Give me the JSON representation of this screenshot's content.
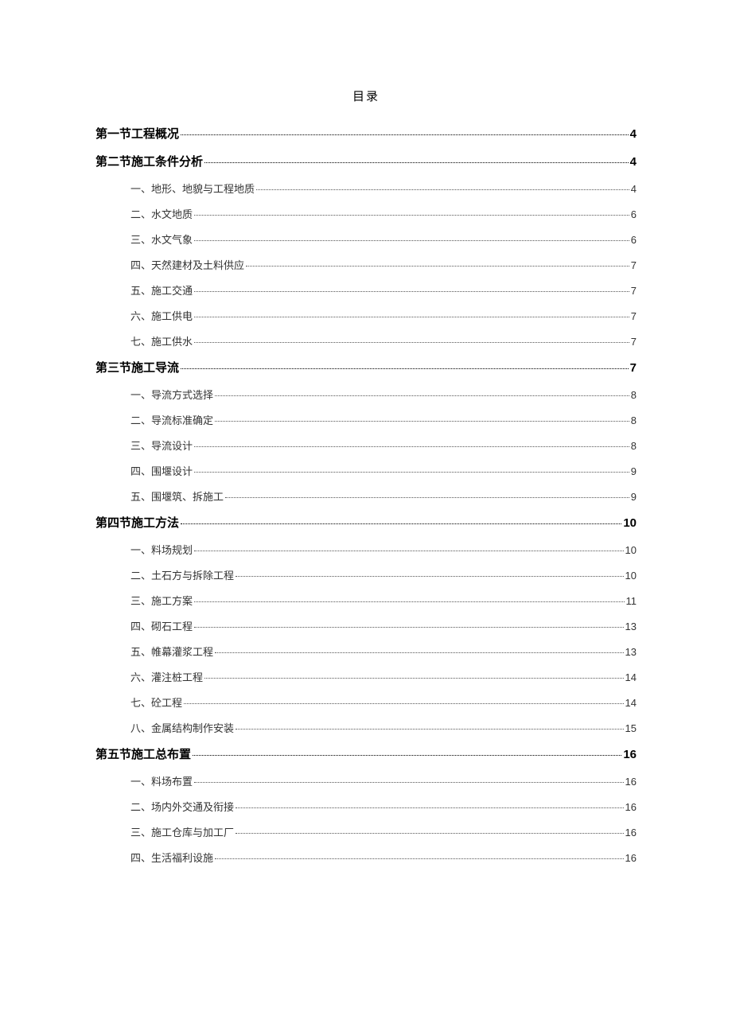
{
  "title": "目录",
  "entries": [
    {
      "level": 1,
      "label": "第一节工程概况",
      "page": "4"
    },
    {
      "level": 1,
      "label": "第二节施工条件分析",
      "page": "4"
    },
    {
      "level": 2,
      "label": "一、地形、地貌与工程地质",
      "page": "4"
    },
    {
      "level": 2,
      "label": "二、水文地质",
      "page": "6"
    },
    {
      "level": 2,
      "label": "三、水文气象",
      "page": "6"
    },
    {
      "level": 2,
      "label": "四、天然建材及土料供应",
      "page": "7"
    },
    {
      "level": 2,
      "label": "五、施工交通",
      "page": "7"
    },
    {
      "level": 2,
      "label": "六、施工供电",
      "page": "7"
    },
    {
      "level": 2,
      "label": "七、施工供水",
      "page": "7"
    },
    {
      "level": 1,
      "label": "第三节施工导流",
      "page": "7"
    },
    {
      "level": 2,
      "label": "一、导流方式选择",
      "page": "8"
    },
    {
      "level": 2,
      "label": "二、导流标准确定",
      "page": "8"
    },
    {
      "level": 2,
      "label": "三、导流设计",
      "page": "8"
    },
    {
      "level": 2,
      "label": "四、围堰设计",
      "page": "9"
    },
    {
      "level": 2,
      "label": "五、围堰筑、拆施工",
      "page": "9"
    },
    {
      "level": 1,
      "label": "第四节施工方法",
      "page": "10"
    },
    {
      "level": 2,
      "label": "一、料场规划",
      "page": "10"
    },
    {
      "level": 2,
      "label": "二、土石方与拆除工程",
      "page": "10"
    },
    {
      "level": 2,
      "label": "三、施工方案",
      "page": "11"
    },
    {
      "level": 2,
      "label": "四、砌石工程",
      "page": "13"
    },
    {
      "level": 2,
      "label": "五、帷幕灌浆工程",
      "page": "13"
    },
    {
      "level": 2,
      "label": "六、灌注桩工程",
      "page": "14"
    },
    {
      "level": 2,
      "label": "七、砼工程",
      "page": "14"
    },
    {
      "level": 2,
      "label": "八、金属结构制作安装",
      "page": "15"
    },
    {
      "level": 1,
      "label": "第五节施工总布置",
      "page": "16"
    },
    {
      "level": 2,
      "label": "一、料场布置",
      "page": "16"
    },
    {
      "level": 2,
      "label": "二、场内外交通及衔接",
      "page": "16"
    },
    {
      "level": 2,
      "label": "三、施工仓库与加工厂",
      "page": "16"
    },
    {
      "level": 2,
      "label": "四、生活福利设施",
      "page": "16"
    }
  ]
}
